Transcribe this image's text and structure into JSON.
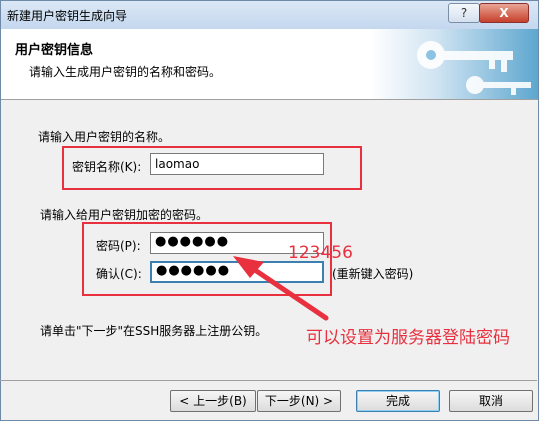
{
  "window": {
    "title": "新建用户密钥生成向导",
    "help_label": "?",
    "close_label": "X"
  },
  "header": {
    "title": "用户密钥信息",
    "subtitle": "请输入生成用户密钥的名称和密码。"
  },
  "name_section": {
    "prompt": "请输入用户密钥的名称。",
    "field_label": "密钥名称(K):",
    "field_value": "laomao"
  },
  "password_section": {
    "prompt": "请输入给用户密钥加密的密码。",
    "password_label": "密码(P):",
    "password_value": "●●●●●●",
    "confirm_label": "确认(C):",
    "confirm_value": "●●●●●●",
    "reenter_hint": "(重新键入密码)"
  },
  "register_note": "请单击\"下一步\"在SSH服务器上注册公钥。",
  "annotations": {
    "password_text": "123456",
    "server_note": "可以设置为服务器登陆密码",
    "color": "#e8303e"
  },
  "buttons": {
    "back": "< 上一步(B)",
    "next": "下一步(N) >",
    "finish": "完成",
    "cancel": "取消"
  }
}
